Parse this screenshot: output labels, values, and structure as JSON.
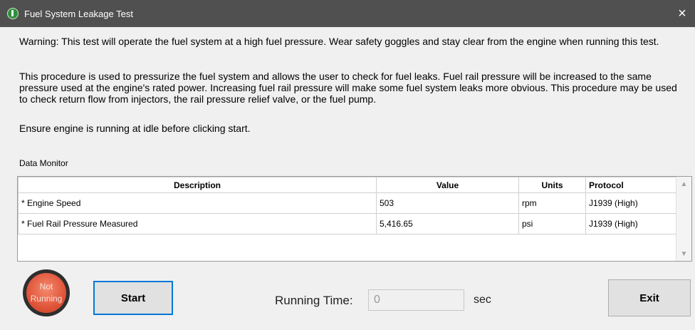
{
  "window": {
    "title": "Fuel System Leakage Test",
    "close_glyph": "×",
    "icon": "app-status-icon"
  },
  "text": {
    "warning": "Warning: This test will operate the fuel system at a high fuel pressure. Wear safety goggles and stay clear from the engine when running this test.",
    "procedure": "This procedure is used to pressurize the fuel system and allows the user to check for fuel leaks. Fuel rail pressure will be increased to the same pressure used at the engine's rated power. Increasing fuel rail pressure will make some fuel system leaks more obvious. This procedure may be used to check return flow from injectors, the rail pressure relief valve, or the fuel pump.",
    "ensure": "Ensure engine is running at idle before clicking start."
  },
  "data_monitor": {
    "label": "Data Monitor",
    "columns": [
      "Description",
      "Value",
      "Units",
      "Protocol"
    ],
    "rows": [
      [
        "* Engine Speed",
        "503",
        "rpm",
        "J1939 (High)"
      ],
      [
        "* Fuel Rail Pressure Measured",
        "5,416.65",
        "psi",
        "J1939 (High)"
      ]
    ],
    "scroll_up": "▲",
    "scroll_down": "▼"
  },
  "status": {
    "line1": "Not",
    "line2": "Running",
    "color": "#e0553a"
  },
  "controls": {
    "start_label": "Start",
    "running_time_label": "Running Time:",
    "running_time_value": "0",
    "running_time_unit": "sec",
    "exit_label": "Exit"
  },
  "colors": {
    "titlebar": "#505050",
    "focus_border": "#0078d7"
  }
}
